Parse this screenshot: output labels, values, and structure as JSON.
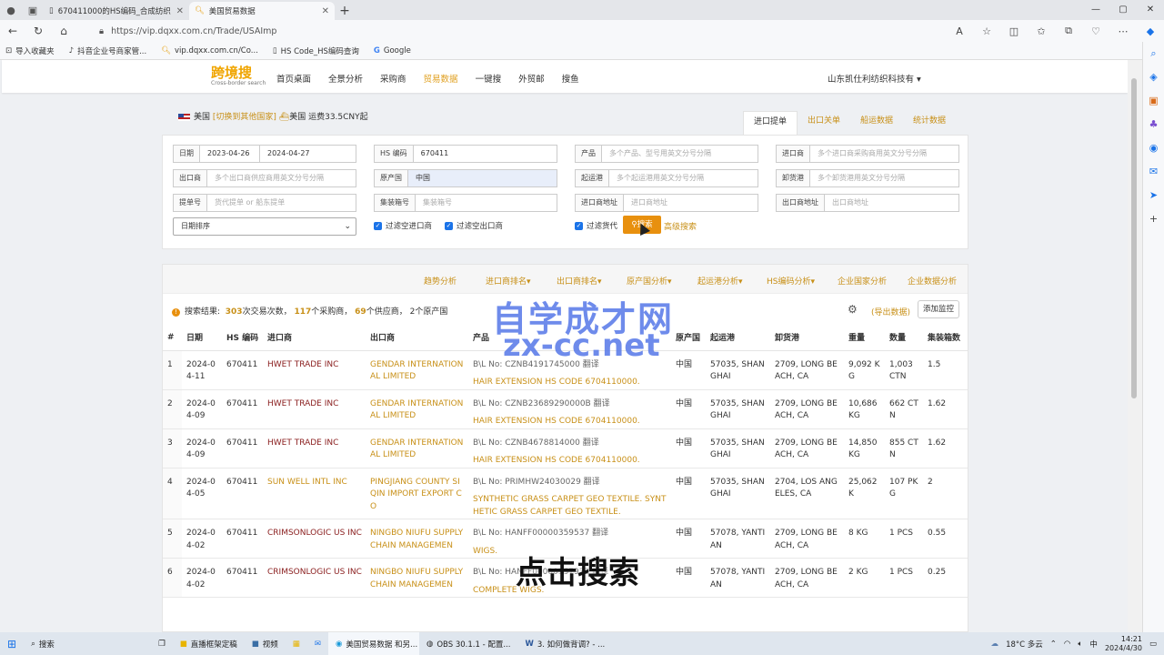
{
  "browser": {
    "tabs": [
      {
        "title": "670411000的HS编码_合成纺织"
      },
      {
        "title": "美国贸易数据"
      }
    ],
    "url": "https://vip.dqxx.com.cn/Trade/USAImp",
    "bookmarks": [
      "导入收藏夹",
      "抖音企业号商家管...",
      "vip.dqxx.com.cn/Co...",
      "HS Code_HS编码查询",
      "Google"
    ]
  },
  "site": {
    "logo": "跨境搜",
    "logo_sub": "Cross-border search",
    "nav": [
      "首页桌面",
      "全景分析",
      "采购商",
      "贸易数据",
      "一键搜",
      "外贸邮",
      "搜鱼"
    ],
    "company": "山东凯仕利纺织科技有 ▾",
    "country": "美国",
    "switch_link": "[切换到其他国家]",
    "shipping": "美国 运费33.5CNY起",
    "subtabs": [
      "进口提单",
      "出口关单",
      "船运数据",
      "统计数据"
    ]
  },
  "form": {
    "date_label": "日期",
    "date_from": "2023-04-26",
    "date_to": "2024-04-27",
    "hs_label": "HS 编码",
    "hs_value": "670411",
    "product_label": "产品",
    "product_ph": "多个产品、型号用英文分号分隔",
    "importer_label": "进口商",
    "importer_ph": "多个进口商采购商用英文分号分隔",
    "exporter_label": "出口商",
    "exporter_ph": "多个出口商供应商用英文分号分隔",
    "origin_label": "原产国",
    "origin_value": "中国",
    "loadport_label": "起运港",
    "loadport_ph": "多个起运港用英文分号分隔",
    "unloadport_label": "卸货港",
    "unloadport_ph": "多个卸货港用英文分号分隔",
    "bl_label": "提单号",
    "bl_ph": "货代提单 or 船东提单",
    "container_label": "集装箱号",
    "container_ph": "集装箱号",
    "impaddr_label": "进口商地址",
    "impaddr_ph": "进口商地址",
    "expaddr_label": "出口商地址",
    "expaddr_ph": "出口商地址",
    "sort": "日期排序",
    "chk1": "过滤空进口商",
    "chk2": "过滤空出口商",
    "chk3": "过滤货代",
    "search_btn": "搜索",
    "adv": "高级搜索"
  },
  "analysis": [
    "趋势分析",
    "进口商排名▾",
    "出口商排名▾",
    "原产国分析▾",
    "起运港分析▾",
    "HS编码分析▾",
    "企业国家分析",
    "企业数据分析"
  ],
  "summary": {
    "label": "搜索结果:",
    "trades": "303",
    "trades_t": "次交易次数，",
    "buyers": "117",
    "buyers_t": "个采购商，",
    "suppliers": "69",
    "suppliers_t": "个供应商，",
    "origins": "2",
    "origins_t": "个原产国"
  },
  "export_link": "(导出数据)",
  "monitor_btn": "添加监控",
  "table": {
    "headers": [
      "#",
      "日期",
      "HS 编码",
      "进口商",
      "出口商",
      "产品",
      "原产国",
      "起运港",
      "卸货港",
      "重量",
      "数量",
      "集装箱数"
    ],
    "rows": [
      {
        "n": "1",
        "date": "2024-04-11",
        "hs": "670411",
        "imp": "HWET TRADE INC",
        "exp": "GENDAR INTERNATIONAL LIMITED",
        "bl": "B\\L No: CZNB4191745000 翻译",
        "prod": "HAIR EXTENSION HS CODE 6704110000.",
        "origin": "中国",
        "lp": "57035, SHANGHAI",
        "up": "2709, LONG BEACH, CA",
        "wt": "9,092 KG",
        "qty": "1,003 CTN",
        "cnt": "1.5"
      },
      {
        "n": "2",
        "date": "2024-04-09",
        "hs": "670411",
        "imp": "HWET TRADE INC",
        "exp": "GENDAR INTERNATIONAL LIMITED",
        "bl": "B\\L No: CZNB23689290000B 翻译",
        "prod": "HAIR EXTENSION HS CODE 6704110000.",
        "origin": "中国",
        "lp": "57035, SHANGHAI",
        "up": "2709, LONG BEACH, CA",
        "wt": "10,686 KG",
        "qty": "662 CTN",
        "cnt": "1.62"
      },
      {
        "n": "3",
        "date": "2024-04-09",
        "hs": "670411",
        "imp": "HWET TRADE INC",
        "exp": "GENDAR INTERNATIONAL LIMITED",
        "bl": "B\\L No: CZNB4678814000 翻译",
        "prod": "HAIR EXTENSION HS CODE 6704110000.",
        "origin": "中国",
        "lp": "57035, SHANGHAI",
        "up": "2709, LONG BEACH, CA",
        "wt": "14,850 KG",
        "qty": "855 CTN",
        "cnt": "1.62"
      },
      {
        "n": "4",
        "date": "2024-04-05",
        "hs": "670411",
        "imp": "SUN WELL INTL INC",
        "exp": "PINGJIANG COUNTY SIQIN IMPORT EXPORT CO",
        "bl": "B\\L No: PRIMHW24030029 翻译",
        "prod": "SYNTHETIC GRASS CARPET GEO TEXTILE. SYNTHETIC GRASS CARPET GEO TEXTILE.",
        "origin": "中国",
        "lp": "57035, SHANGHAI",
        "up": "2704, LOS ANGELES, CA",
        "wt": "25,062 K",
        "qty": "107 PKG",
        "cnt": "2"
      },
      {
        "n": "5",
        "date": "2024-04-02",
        "hs": "670411",
        "imp": "CRIMSONLOGIC US INC",
        "exp": "NINGBO NIUFU SUPPLY CHAIN MANAGEMEN",
        "bl": "B\\L No: HANFF00000359537 翻译",
        "prod": "WIGS.",
        "origin": "中国",
        "lp": "57078, YANTIAN",
        "up": "2709, LONG BEACH, CA",
        "wt": "8 KG",
        "qty": "1 PCS",
        "cnt": "0.55"
      },
      {
        "n": "6",
        "date": "2024-04-02",
        "hs": "670411",
        "imp": "CRIMSONLOGIC US INC",
        "exp": "NINGBO NIUFU SUPPLY CHAIN MANAGEMEN",
        "bl": "B\\L No: HANFF00000357932 翻译",
        "prod": "COMPLETE WIGS.",
        "origin": "中国",
        "lp": "57078, YANTIAN",
        "up": "2709, LONG BEACH, CA",
        "wt": "2 KG",
        "qty": "1 PCS",
        "cnt": "0.25"
      }
    ]
  },
  "overlay": {
    "wm1": "自学成才网",
    "wm2": "zx-cc.net",
    "caption": "点击搜索"
  },
  "taskbar": {
    "search": "搜索",
    "apps": [
      "直播框架定稿",
      "视频",
      "美国贸易数据 和另...",
      "OBS 30.1.1 - 配置...",
      "3. 如何做背调? - ..."
    ],
    "weather": "18°C 多云",
    "ime": "中",
    "time": "14:21",
    "date": "2024/4/30"
  }
}
